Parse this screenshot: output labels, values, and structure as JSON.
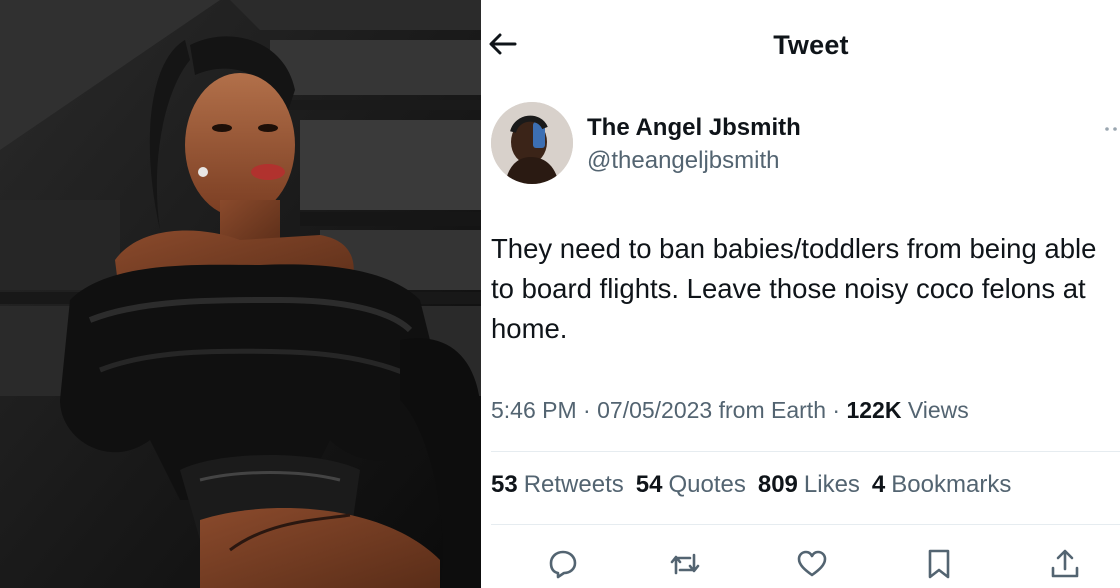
{
  "header": {
    "title": "Tweet"
  },
  "tweet": {
    "display_name": "The Angel Jbsmith",
    "handle": "@theangeljbsmith",
    "text": "They need to ban babies/toddlers from being able to board flights. Leave those noisy coco felons at home.",
    "time": "5:46 PM",
    "date": "07/05/2023",
    "source": "from Earth",
    "views_count": "122K",
    "views_label": "Views"
  },
  "stats": [
    {
      "count": "53",
      "label": "Retweets"
    },
    {
      "count": "54",
      "label": "Quotes"
    },
    {
      "count": "809",
      "label": "Likes"
    },
    {
      "count": "4",
      "label": "Bookmarks"
    }
  ],
  "icons": {
    "back": "arrow-left-icon",
    "reply": "reply-icon",
    "retweet": "retweet-icon",
    "like": "heart-icon",
    "bookmark": "bookmark-icon",
    "share": "share-icon"
  },
  "colors": {
    "text_primary": "#0f1419",
    "text_secondary": "#536471",
    "divider": "#e6ecf0"
  }
}
